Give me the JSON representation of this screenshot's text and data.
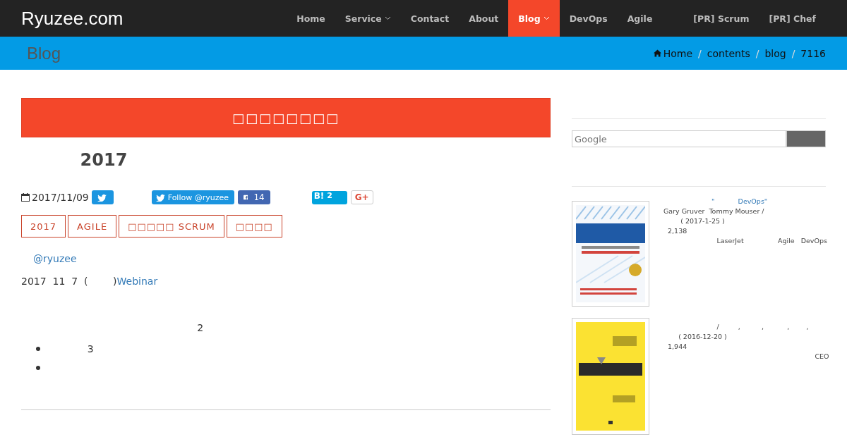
{
  "navbar": {
    "brand": "Ryuzee.com",
    "items": [
      {
        "label": "Home",
        "selected": false,
        "dropdown": false
      },
      {
        "label": "Service",
        "selected": false,
        "dropdown": true
      },
      {
        "label": "Contact",
        "selected": false,
        "dropdown": false
      },
      {
        "label": "About",
        "selected": false,
        "dropdown": false
      },
      {
        "label": "Blog",
        "selected": true,
        "dropdown": true
      },
      {
        "label": "DevOps",
        "selected": false,
        "dropdown": false
      },
      {
        "label": "Agile",
        "selected": false,
        "dropdown": false
      },
      {
        "label": "[PR] Scrum",
        "selected": false,
        "dropdown": false
      },
      {
        "label": "[PR] Chef",
        "selected": false,
        "dropdown": false
      }
    ]
  },
  "page_header": {
    "title": "Blog",
    "separator": "/",
    "breadcrumb": [
      "Home",
      "contents",
      "blog",
      "7116"
    ]
  },
  "post": {
    "banner": "□□□□□□□□",
    "title": "          2017",
    "date": "2017/11/09",
    "share": [
      {
        "kind": "tweet"
      },
      {
        "kind": "follow",
        "label": "Follow @ryuzee"
      },
      {
        "kind": "facebook",
        "count": "14"
      },
      {
        "kind": "hatena",
        "label": "B!",
        "count": "2"
      },
      {
        "kind": "gplus",
        "label": "G+"
      }
    ],
    "tags": [
      "2017",
      "AGILE",
      "□□□□□ SCRUM",
      "□□□□"
    ],
    "author_link": "@ryuzee",
    "line": {
      "text": "2017  11  7  (        )",
      "link": "Webinar"
    },
    "paragraph": "                                                        2",
    "bullets": [
      {
        "kind": "text",
        "text": "               3"
      },
      {
        "kind": "blank"
      }
    ]
  },
  "sidebar": {
    "search": {
      "placeholder": "Google"
    },
    "books": [
      {
        "title": "\"           DevOps\"",
        "lines": [
          "Gary Gruver  Tommy Mouser /",
          "        ( 2017-1-25 )",
          "  2,138",
          "                         LaserJet                Agile   DevOps"
        ]
      },
      {
        "lines": [
          "                         /         ,          ,           ,        ,",
          "       ( 2016-12-20 )",
          "  1,944",
          "                                                                       CEO"
        ]
      }
    ]
  }
}
